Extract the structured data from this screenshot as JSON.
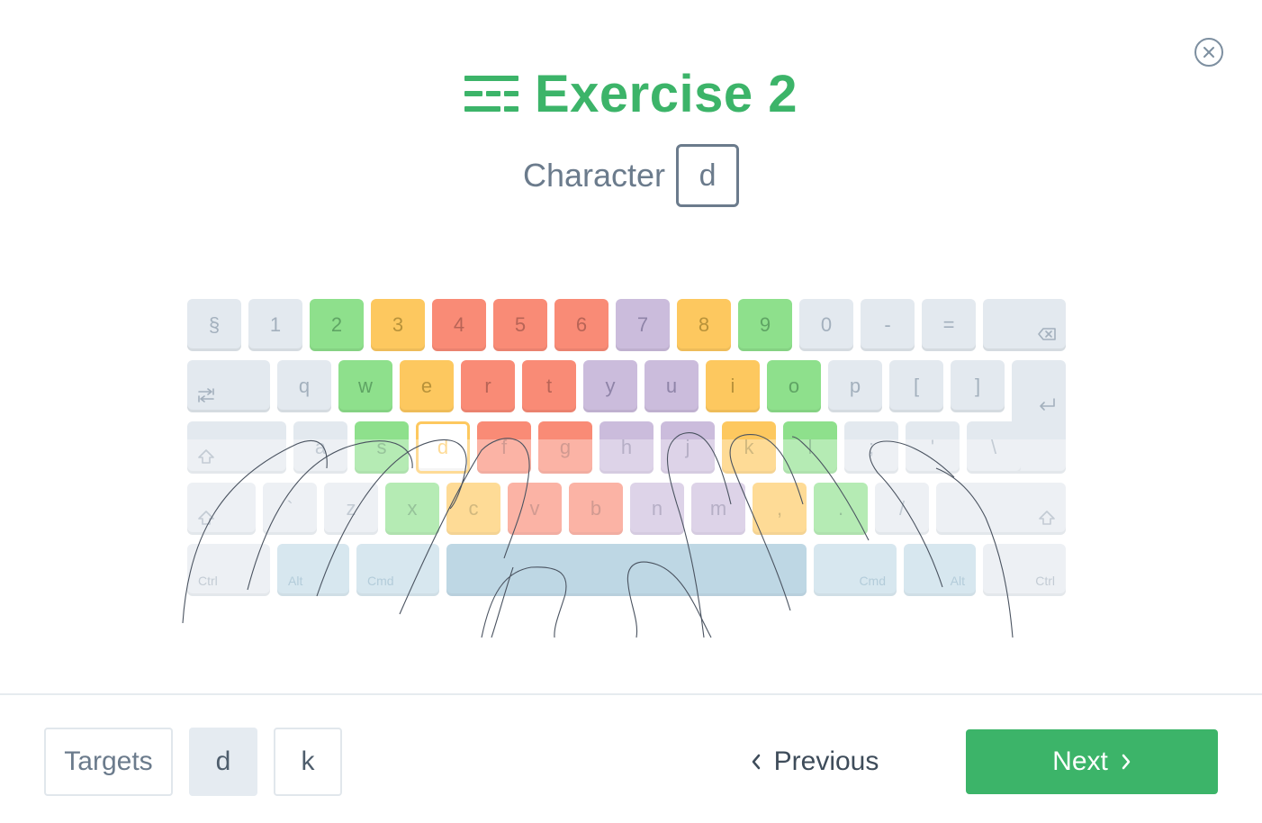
{
  "header": {
    "title": "Exercise 2"
  },
  "character": {
    "label": "Character",
    "value": "d"
  },
  "keyboard": {
    "colors": {
      "green": "#8ee08c",
      "yellow": "#fdc85f",
      "red": "#f98b76",
      "purple": "#cbbcdc",
      "gray": "#e3e9ef",
      "blue": "#c2dae6",
      "blue_dark": "#9cc2d6",
      "target_border": "#fdc85f"
    },
    "rows": [
      [
        {
          "label": "§",
          "color": "gray"
        },
        {
          "label": "1",
          "color": "gray"
        },
        {
          "label": "2",
          "color": "green"
        },
        {
          "label": "3",
          "color": "yellow"
        },
        {
          "label": "4",
          "color": "red"
        },
        {
          "label": "5",
          "color": "red"
        },
        {
          "label": "6",
          "color": "red"
        },
        {
          "label": "7",
          "color": "purple"
        },
        {
          "label": "8",
          "color": "yellow"
        },
        {
          "label": "9",
          "color": "green"
        },
        {
          "label": "0",
          "color": "gray"
        },
        {
          "label": "-",
          "color": "gray"
        },
        {
          "label": "=",
          "color": "gray"
        },
        {
          "label": "",
          "icon": "backspace-icon",
          "color": "gray",
          "wide": true
        }
      ],
      [
        {
          "label": "",
          "icon": "tab-icon",
          "color": "gray",
          "wide": true
        },
        {
          "label": "q",
          "color": "gray"
        },
        {
          "label": "w",
          "color": "green"
        },
        {
          "label": "e",
          "color": "yellow"
        },
        {
          "label": "r",
          "color": "red"
        },
        {
          "label": "t",
          "color": "red"
        },
        {
          "label": "y",
          "color": "purple"
        },
        {
          "label": "u",
          "color": "purple"
        },
        {
          "label": "i",
          "color": "yellow"
        },
        {
          "label": "o",
          "color": "green"
        },
        {
          "label": "p",
          "color": "gray"
        },
        {
          "label": "[",
          "color": "gray"
        },
        {
          "label": "]",
          "color": "gray"
        },
        {
          "label": "",
          "icon": "enter-icon",
          "color": "gray",
          "wide": true
        }
      ],
      [
        {
          "label": "",
          "icon": "caps-lock-icon",
          "color": "gray",
          "wide": true
        },
        {
          "label": "a",
          "color": "gray"
        },
        {
          "label": "s",
          "color": "green"
        },
        {
          "label": "d",
          "color": "target"
        },
        {
          "label": "f",
          "color": "red"
        },
        {
          "label": "g",
          "color": "red"
        },
        {
          "label": "h",
          "color": "purple"
        },
        {
          "label": "j",
          "color": "purple"
        },
        {
          "label": "k",
          "color": "yellow"
        },
        {
          "label": "l",
          "color": "green"
        },
        {
          "label": ";",
          "color": "gray"
        },
        {
          "label": "'",
          "color": "gray"
        },
        {
          "label": "\\",
          "color": "gray"
        }
      ],
      [
        {
          "label": "",
          "icon": "shift-icon",
          "color": "gray",
          "wide": true
        },
        {
          "label": "`",
          "color": "gray"
        },
        {
          "label": "z",
          "color": "gray"
        },
        {
          "label": "x",
          "color": "green"
        },
        {
          "label": "c",
          "color": "yellow"
        },
        {
          "label": "v",
          "color": "red"
        },
        {
          "label": "b",
          "color": "red"
        },
        {
          "label": "n",
          "color": "purple"
        },
        {
          "label": "m",
          "color": "purple"
        },
        {
          "label": ",",
          "color": "yellow"
        },
        {
          "label": ".",
          "color": "green"
        },
        {
          "label": "/",
          "color": "gray"
        },
        {
          "label": "",
          "icon": "shift-icon",
          "color": "gray",
          "wide": true
        }
      ],
      [
        {
          "label": "Ctrl",
          "color": "gray",
          "mod": true
        },
        {
          "label": "Alt",
          "color": "blue",
          "mod": true
        },
        {
          "label": "Cmd",
          "color": "blue",
          "mod": true
        },
        {
          "label": "",
          "color": "blue_dark",
          "space": true
        },
        {
          "label": "Cmd",
          "color": "blue",
          "mod": true
        },
        {
          "label": "Alt",
          "color": "blue",
          "mod": true
        },
        {
          "label": "Ctrl",
          "color": "gray",
          "mod": true
        }
      ]
    ]
  },
  "footer": {
    "targets_label": "Targets",
    "targets": [
      "d",
      "k"
    ],
    "previous_label": "Previous",
    "next_label": "Next"
  }
}
